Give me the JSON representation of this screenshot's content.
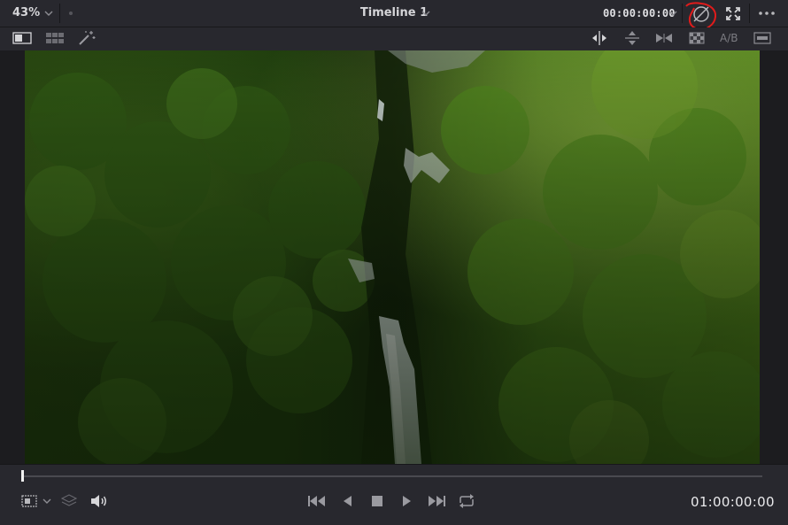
{
  "viewer": {
    "zoom_label": "43%",
    "timeline_title": "Timeline 1",
    "timecode": "00:00:00:00",
    "ab_label": "A/B",
    "current_timecode": "01:00:00:00"
  },
  "icons": {
    "top": [
      "zoom-dropdown-chevron",
      "title-dropdown-chevron",
      "timecode-dropdown-chevron",
      "bypass-grade-icon",
      "fullscreen-icon",
      "more-options-icon"
    ],
    "toolbar": [
      "single-viewer-icon",
      "gallery-grid-icon",
      "magic-wand-icon",
      "split-wipe-icon",
      "vertical-wipe-icon",
      "mix-icon",
      "checkerboard-icon",
      "ab-wipe-icon",
      "viewer-mode-icon"
    ],
    "transport": [
      "viewer-layout-icon",
      "layers-icon",
      "volume-icon",
      "jump-to-start-icon",
      "reverse-play-icon",
      "stop-icon",
      "play-icon",
      "jump-to-end-icon",
      "loop-icon"
    ]
  },
  "colors": {
    "annotation": "#e11b1b",
    "panel": "#28282e",
    "background": "#1c1c1f"
  }
}
